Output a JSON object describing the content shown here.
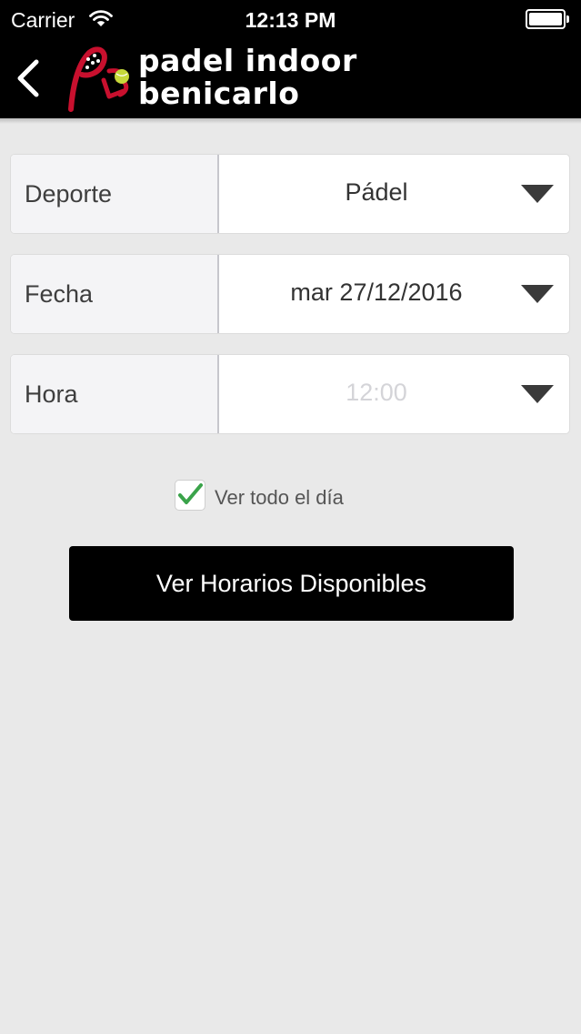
{
  "status_bar": {
    "carrier": "Carrier",
    "time": "12:13 PM",
    "battery_level": 1.0
  },
  "header": {
    "logo_line_1": "padel indoor",
    "logo_line_2": "benicarlo",
    "logo_monogram": "PIB",
    "brand_color": "#c8102e",
    "ball_color": "#c6d93a"
  },
  "form": {
    "deporte": {
      "label": "Deporte",
      "value": "Pádel"
    },
    "fecha": {
      "label": "Fecha",
      "value": "mar 27/12/2016"
    },
    "hora": {
      "label": "Hora",
      "value": "12:00"
    },
    "all_day": {
      "label": "Ver todo el día",
      "checked": true,
      "check_color": "#3aa34a"
    }
  },
  "submit_button": {
    "label": "Ver Horarios Disponibles"
  }
}
